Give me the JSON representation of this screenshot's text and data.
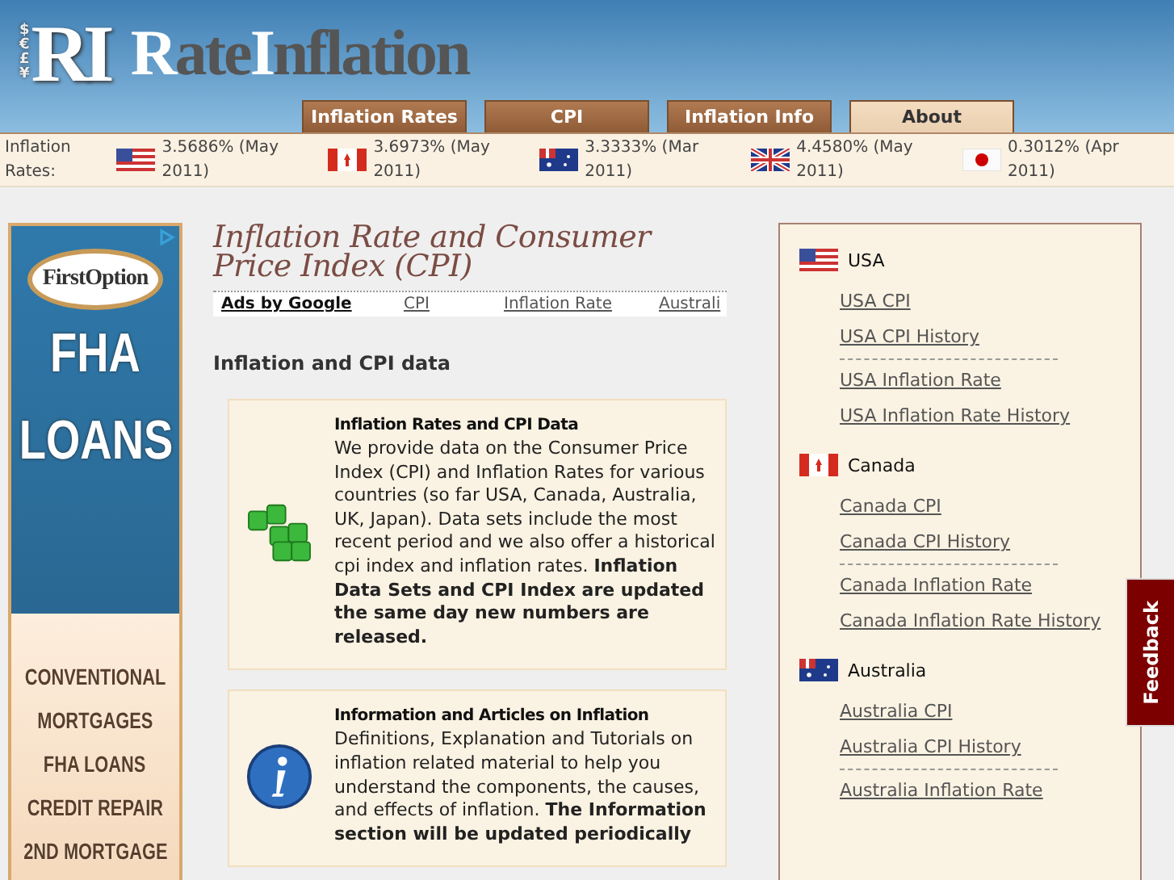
{
  "logo": {
    "badge": "RI",
    "currency": [
      "$",
      "€",
      "£",
      "¥"
    ],
    "parts": [
      {
        "text": "R",
        "highlight": true
      },
      {
        "text": "ate",
        "highlight": false
      },
      {
        "text": "I",
        "highlight": true
      },
      {
        "text": "nflation",
        "highlight": false
      }
    ]
  },
  "tabs": [
    {
      "label": "Inflation Rates",
      "selected": false
    },
    {
      "label": "CPI",
      "selected": false
    },
    {
      "label": "Inflation Info",
      "selected": false
    },
    {
      "label": "About",
      "selected": true
    }
  ],
  "rates_bar": {
    "label": "Inflation Rates:",
    "items": [
      {
        "text": "3.5686% (May 2011)"
      },
      {
        "text": "3.6973% (May 2011)"
      },
      {
        "text": "3.3333% (Mar 2011)"
      },
      {
        "text": "4.4580% (May 2011)"
      },
      {
        "text": "0.3012% (Apr 2011)"
      }
    ]
  },
  "ad_banner": {
    "brand": "FirstOption",
    "headline": [
      "FHA",
      "LOANS"
    ],
    "services": [
      "CONVENTIONAL",
      "MORTGAGES",
      "FHA LOANS",
      "CREDIT REPAIR",
      "2ND MORTGAGE"
    ]
  },
  "page_title": "Inflation Rate and Consumer Price Index (CPI)",
  "ad_links": {
    "label": "Ads by Google",
    "links": [
      "CPI",
      "Inflation Rate",
      "Australi"
    ]
  },
  "section_heading": "Inflation and CPI data",
  "cards": [
    {
      "title": "Inflation Rates and CPI Data",
      "text": "We provide data on the Consumer Price Index (CPI) and Inflation Rates for various countries (so far USA, Canada, Australia, UK, Japan). Data sets include the most recent period and we also offer a historical cpi index and inflation rates. **Inflation Data Sets and CPI Index are updated the same day new numbers are released.**"
    },
    {
      "title": "Information and Articles on Inflation",
      "text": "Definitions, Explanation and Tutorials on inflation related material to help you understand the components, the causes, and effects of inflation. **The Information section will be updated periodically**"
    }
  ],
  "sidebar": {
    "countries": [
      {
        "name": "USA",
        "links": [
          {
            "kind": "link",
            "label": "USA CPI"
          },
          {
            "kind": "link",
            "label": "USA CPI History"
          },
          {
            "kind": "separator"
          },
          {
            "kind": "link",
            "label": "USA Inflation Rate"
          },
          {
            "kind": "link",
            "label": "USA Inflation Rate History"
          }
        ]
      },
      {
        "name": "Canada",
        "links": [
          {
            "kind": "link",
            "label": "Canada CPI"
          },
          {
            "kind": "link",
            "label": "Canada CPI History"
          },
          {
            "kind": "separator"
          },
          {
            "kind": "link",
            "label": "Canada Inflation Rate"
          },
          {
            "kind": "link",
            "label": "Canada Inflation Rate History"
          }
        ]
      },
      {
        "name": "Australia",
        "links": [
          {
            "kind": "link",
            "label": "Australia CPI"
          },
          {
            "kind": "link",
            "label": "Australia CPI History"
          },
          {
            "kind": "separator"
          },
          {
            "kind": "link",
            "label": "Australia Inflation Rate"
          }
        ]
      }
    ]
  },
  "feedback_tab": "Feedback"
}
